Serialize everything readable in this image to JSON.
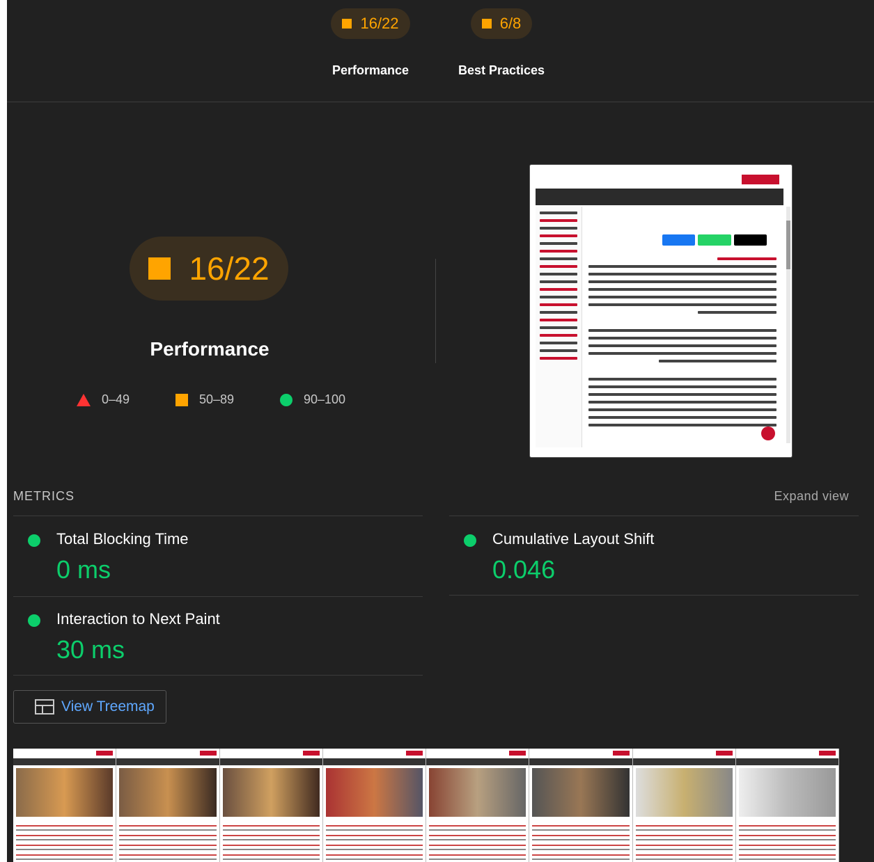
{
  "categories": [
    {
      "score": "16/22",
      "label": "Performance"
    },
    {
      "score": "6/8",
      "label": "Best Practices"
    }
  ],
  "gauge": {
    "score": "16/22",
    "title": "Performance"
  },
  "legend": [
    {
      "range": "0–49",
      "shape": "triangle",
      "color": "#ff3333"
    },
    {
      "range": "50–89",
      "shape": "square",
      "color": "#ffa400"
    },
    {
      "range": "90–100",
      "shape": "circle",
      "color": "#0cce6b"
    }
  ],
  "metrics_section": {
    "title": "METRICS",
    "expand_label": "Expand view"
  },
  "metrics": [
    {
      "name": "Total Blocking Time",
      "value": "0 ms",
      "status": "pass"
    },
    {
      "name": "Cumulative Layout Shift",
      "value": "0.046",
      "status": "pass"
    },
    {
      "name": "Interaction to Next Paint",
      "value": "30 ms",
      "status": "pass"
    }
  ],
  "treemap_button": {
    "label": "View Treemap"
  },
  "colors": {
    "average": "#ffa400",
    "pass": "#0cce6b",
    "fail": "#ff3333",
    "link": "#5fa8ff",
    "background": "#212121"
  },
  "filmstrip": {
    "frame_count": 8
  }
}
